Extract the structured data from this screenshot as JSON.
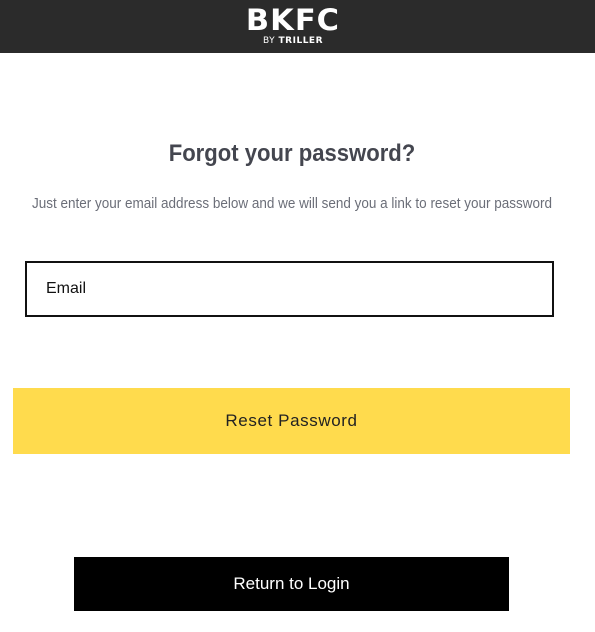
{
  "header": {
    "logo_text": "BKFC",
    "logo_sub_prefix": "BY",
    "logo_sub_brand": "TRILLER",
    "background_color": "#2b2b2b"
  },
  "main": {
    "title": "Forgot your password?",
    "subtitle": "Just enter your email address below and we will send you a link to reset your password",
    "email_input": {
      "value": "",
      "placeholder": "Email"
    },
    "reset_button_label": "Reset Password",
    "reset_button_color": "#ffdb4d",
    "login_button_label": "Return to Login",
    "login_button_color": "#000000"
  }
}
